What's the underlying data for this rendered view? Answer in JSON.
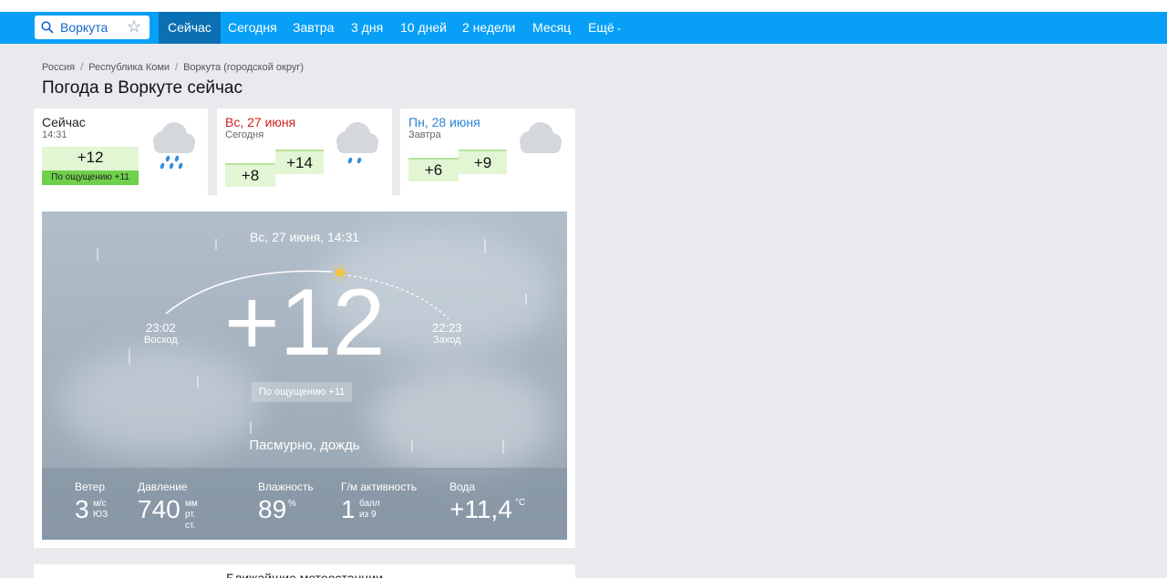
{
  "search": {
    "value": "Воркута",
    "icon": "search-icon",
    "favorite_icon": "star-icon"
  },
  "nav": {
    "items": [
      {
        "label": "Сейчас",
        "active": true
      },
      {
        "label": "Сегодня"
      },
      {
        "label": "Завтра"
      },
      {
        "label": "3 дня"
      },
      {
        "label": "10 дней"
      },
      {
        "label": "2 недели"
      },
      {
        "label": "Месяц"
      },
      {
        "label": "Ещё"
      }
    ],
    "more_chevron": "⌄"
  },
  "breadcrumb": {
    "items": [
      "Россия",
      "Республика Коми",
      "Воркута (городской округ)"
    ],
    "separator": "/"
  },
  "page_title": "Погода в Воркуте сейчас",
  "cards": {
    "now": {
      "label": "Сейчас",
      "time": "14:31",
      "temp": "+12",
      "feels": "По ощущению +11",
      "icon": "cloud-rain-icon"
    },
    "today": {
      "label": "Вс, 27 июня",
      "sub": "Сегодня",
      "night": "+8",
      "day": "+14",
      "icon": "cloud-rain-icon"
    },
    "tomorrow": {
      "label": "Пн, 28 июня",
      "sub": "Завтра",
      "night": "+6",
      "day": "+9",
      "icon": "cloud-icon"
    }
  },
  "current": {
    "datetime": "Вс, 27 июня, 14:31",
    "temp": "+12",
    "feels": "По ощущению +11",
    "description": "Пасмурно, дождь",
    "sunrise": {
      "time": "23:02",
      "label": "Восход"
    },
    "sunset": {
      "time": "22:23",
      "label": "Заход"
    },
    "stats": {
      "wind": {
        "label": "Ветер",
        "value": "3",
        "unit1": "м/с",
        "unit2": "ЮЗ"
      },
      "pressure": {
        "label": "Давление",
        "value": "740",
        "unit1": "мм",
        "unit2": "рт. ст."
      },
      "humidity": {
        "label": "Влажность",
        "value": "89",
        "unit1": "%"
      },
      "geomag": {
        "label": "Г/м активность",
        "value": "1",
        "unit1": "балл",
        "unit2": "из 9"
      },
      "water": {
        "label": "Вода",
        "value": "+11,4",
        "unit1": "°C"
      }
    }
  },
  "nearest_stations": "Ближайшие метеостанции"
}
